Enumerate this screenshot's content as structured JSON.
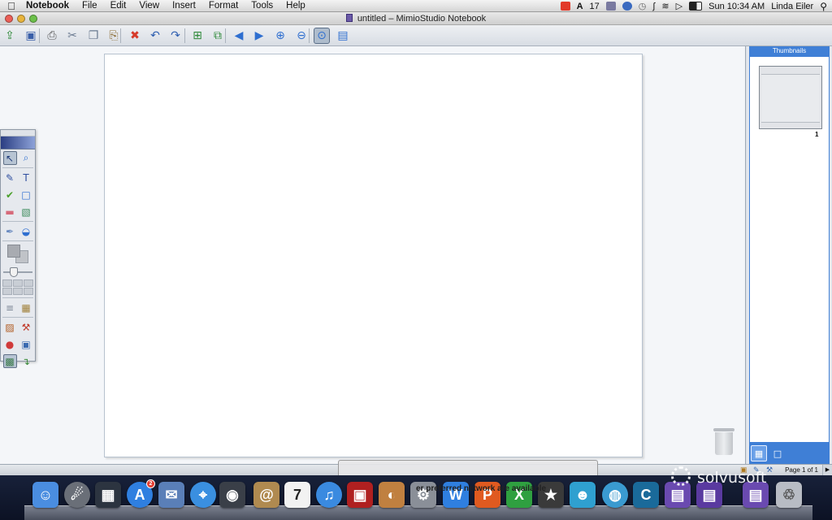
{
  "menubar": {
    "app_name": "Notebook",
    "items": [
      "File",
      "Edit",
      "View",
      "Insert",
      "Format",
      "Tools",
      "Help"
    ],
    "status": {
      "badge_count": "17",
      "clock": "Sun 10:34 AM",
      "user": "Linda Eiler"
    },
    "tray_icons": [
      "flag-icon",
      "adobe-icon",
      "script-icon",
      "sync-icon",
      "time-machine-icon",
      "bluetooth-icon",
      "wifi-icon",
      "volume-icon",
      "battery-icon",
      "spotlight-icon"
    ]
  },
  "window": {
    "title": "untitled – MimioStudio Notebook"
  },
  "toolbar": {
    "tools": [
      {
        "name": "open-icon",
        "glyph": "⇪",
        "color": "#2f8a3a"
      },
      {
        "name": "save-icon",
        "glyph": "▣",
        "color": "#3a5fa8"
      },
      {
        "name": "print-icon",
        "glyph": "⎙",
        "color": "#5a5a5a"
      },
      {
        "name": "cut-icon",
        "glyph": "✂",
        "color": "#6a7a90"
      },
      {
        "name": "copy-icon",
        "glyph": "❐",
        "color": "#6a7a90"
      },
      {
        "name": "paste-icon",
        "glyph": "⎘",
        "color": "#8a6a30"
      },
      {
        "name": "delete-icon",
        "glyph": "✖",
        "color": "#d63a2a"
      },
      {
        "name": "undo-icon",
        "glyph": "↶",
        "color": "#2f5fb0"
      },
      {
        "name": "redo-icon",
        "glyph": "↷",
        "color": "#2f5fb0"
      },
      {
        "name": "new-page-icon",
        "glyph": "⊞",
        "color": "#2f8a3a"
      },
      {
        "name": "duplicate-page-icon",
        "glyph": "⧉",
        "color": "#2f8a3a"
      },
      {
        "name": "previous-page-icon",
        "glyph": "◀",
        "color": "#2f6fd0"
      },
      {
        "name": "next-page-icon",
        "glyph": "▶",
        "color": "#2f6fd0"
      },
      {
        "name": "zoom-in-icon",
        "glyph": "⊕",
        "color": "#2f6fd0"
      },
      {
        "name": "zoom-out-icon",
        "glyph": "⊖",
        "color": "#2f6fd0"
      },
      {
        "name": "zoom-fit-icon",
        "glyph": "⊙",
        "color": "#2f6fd0"
      },
      {
        "name": "reveal-icon",
        "glyph": "▤",
        "color": "#2f6fd0"
      }
    ]
  },
  "palette": {
    "rows": [
      [
        {
          "name": "select-tool-icon",
          "glyph": "↖",
          "color": "#1e3a7a"
        },
        {
          "name": "zoom-tool-icon",
          "glyph": "⌕",
          "color": "#2f6fd0"
        }
      ],
      [
        {
          "name": "pen-tool-icon",
          "glyph": "✎",
          "color": "#2f4fa0"
        },
        {
          "name": "text-tool-icon",
          "glyph": "T",
          "color": "#2f4fa0"
        }
      ],
      [
        {
          "name": "highlighter-tool-icon",
          "glyph": "✔",
          "color": "#4aa02a"
        },
        {
          "name": "shape-tool-icon",
          "glyph": "□",
          "color": "#2f6fd0"
        }
      ],
      [
        {
          "name": "eraser-tool-icon",
          "glyph": "▬",
          "color": "#d66a7a"
        },
        {
          "name": "image-tool-icon",
          "glyph": "▧",
          "color": "#3a8a5a"
        }
      ],
      [
        {
          "name": "eyedropper-tool-icon",
          "glyph": "✒",
          "color": "#6a8ac0"
        },
        {
          "name": "fill-tool-icon",
          "glyph": "◒",
          "color": "#2f6fd0"
        }
      ]
    ],
    "bottom_rows": [
      [
        {
          "name": "line-style-icon",
          "glyph": "≡",
          "color": "#7a8494"
        },
        {
          "name": "layers-icon",
          "glyph": "▦",
          "color": "#a0803a"
        }
      ],
      [
        {
          "name": "presentation-icon",
          "glyph": "▨",
          "color": "#b05a20"
        },
        {
          "name": "tools-icon",
          "glyph": "⚒",
          "color": "#c03a2a"
        }
      ],
      [
        {
          "name": "recorder-icon",
          "glyph": "●",
          "color": "#d03a3a"
        },
        {
          "name": "screen-capture-icon",
          "glyph": "▣",
          "color": "#3a6ab0"
        }
      ],
      [
        {
          "name": "gallery-icon",
          "glyph": "▩",
          "color": "#3a7a4a"
        },
        {
          "name": "import-icon",
          "glyph": "↴",
          "color": "#3a8a3a"
        }
      ]
    ],
    "slider_level": 0.35
  },
  "thumbnails": {
    "header": "Thumbnails",
    "pages": [
      {
        "number": "1"
      }
    ]
  },
  "status": {
    "page_indicator": "Page 1 of 1"
  },
  "dock": {
    "items": [
      {
        "name": "finder-icon",
        "color": "#4a8de0",
        "glyph": "☺"
      },
      {
        "name": "launchpad-icon",
        "color": "#6a6f78",
        "glyph": "☄",
        "round": true
      },
      {
        "name": "mission-control-icon",
        "color": "#2c3440",
        "glyph": "▦"
      },
      {
        "name": "app-store-icon",
        "color": "#2f7fe0",
        "glyph": "A",
        "round": true,
        "badge": "2"
      },
      {
        "name": "mail-stamp-icon",
        "color": "#5a7fb8",
        "glyph": "✉"
      },
      {
        "name": "safari-icon",
        "color": "#3a8fe0",
        "glyph": "⌖",
        "round": true
      },
      {
        "name": "facetime-icon",
        "color": "#3a3f48",
        "glyph": "◉"
      },
      {
        "name": "address-book-icon",
        "color": "#b08a50",
        "glyph": "@"
      },
      {
        "name": "calendar-icon",
        "color": "#f2f2f2",
        "glyph": "7",
        "text_color": "#222"
      },
      {
        "name": "itunes-icon",
        "color": "#3a8ae0",
        "glyph": "♫",
        "round": true
      },
      {
        "name": "photo-booth-icon",
        "color": "#b02020",
        "glyph": "▣"
      },
      {
        "name": "iphoto-icon",
        "color": "#c08040",
        "glyph": "◐"
      },
      {
        "name": "system-preferences-icon",
        "color": "#8a8f98",
        "glyph": "⚙"
      },
      {
        "name": "word-icon",
        "color": "#2f7fe0",
        "glyph": "W"
      },
      {
        "name": "powerpoint-icon",
        "color": "#e05a20",
        "glyph": "P"
      },
      {
        "name": "excel-icon",
        "color": "#2fa040",
        "glyph": "X"
      },
      {
        "name": "imovie-icon",
        "color": "#3a3a3a",
        "glyph": "★"
      },
      {
        "name": "messenger-icon",
        "color": "#2fa0d0",
        "glyph": "☻"
      },
      {
        "name": "network-icon",
        "color": "#3a9ad0",
        "glyph": "◍",
        "round": true
      },
      {
        "name": "c-app-icon",
        "color": "#1a6a9a",
        "glyph": "C"
      },
      {
        "name": "mimio-notebook-icon",
        "color": "#6a4ab0",
        "glyph": "▤"
      },
      {
        "name": "mimio-studio-icon",
        "color": "#5a3aa0",
        "glyph": "▤"
      },
      {
        "name": "document-icon",
        "color": "#6a4ab0",
        "glyph": "▤"
      },
      {
        "name": "trash-icon",
        "color": "#b8bcc4",
        "glyph": "♲",
        "text_color": "#555"
      }
    ],
    "overlay_text": "er preferred network are available"
  },
  "watermark": {
    "text": "solvusoft"
  }
}
